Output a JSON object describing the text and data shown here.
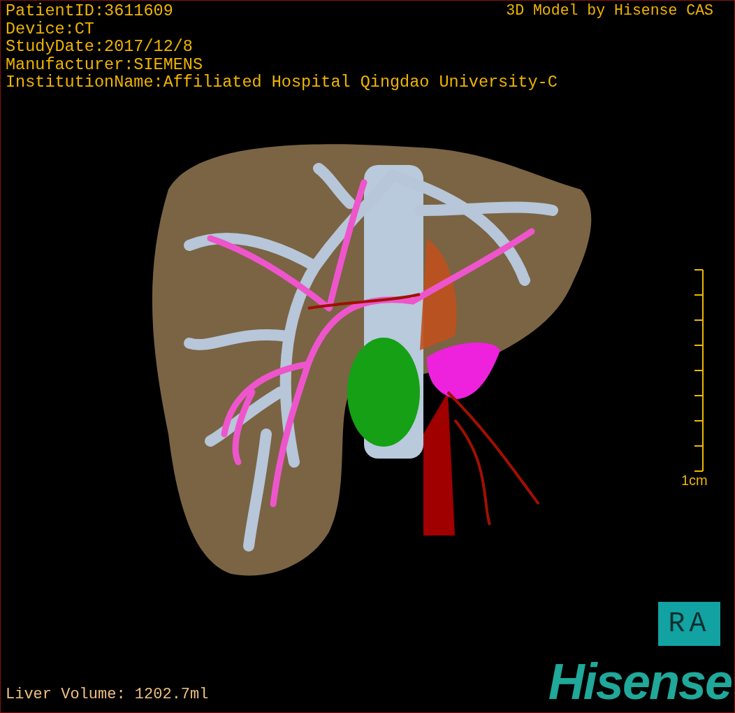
{
  "patient_info": [
    "PatientID:3611609",
    "Device:CT",
    "StudyDate:2017/12/8",
    "Manufacturer:SIEMENS",
    "InstitutionName:Affiliated Hospital Qingdao University-C"
  ],
  "model_title": "3D Model by Hisense CAS",
  "scale_bar": {
    "label": "1cm"
  },
  "orientation": "RA",
  "liver_volume": "Liver Volume: 1202.7ml",
  "logo": "Hisense"
}
